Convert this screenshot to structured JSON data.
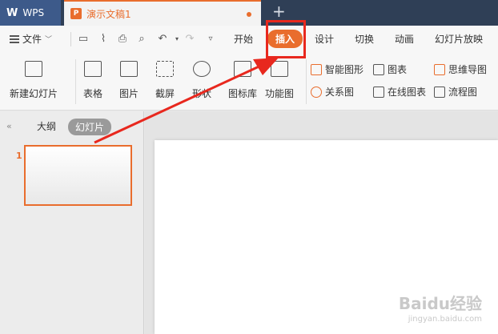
{
  "titlebar": {
    "wps_tab": "WPS",
    "doc_tab": "演示文稿1",
    "new_tab": "+"
  },
  "menubar": {
    "file_label": "文件",
    "tabs": [
      "开始",
      "插入",
      "设计",
      "切换",
      "动画",
      "幻灯片放映"
    ],
    "active_tab": "插入"
  },
  "ribbon": {
    "new_slide": "新建幻灯片",
    "table": "表格",
    "picture": "图片",
    "screenshot": "截屏",
    "shape": "形状",
    "icon_lib": "图标库",
    "func_chart": "功能图",
    "smart_graphic": "智能图形",
    "chart": "图表",
    "mind_map": "思维导图",
    "relation_chart": "关系图",
    "online_chart": "在线图表",
    "flowchart": "流程图"
  },
  "leftpane": {
    "collapse": "«",
    "outline_tab": "大纲",
    "slides_tab": "幻灯片",
    "slide_number": "1"
  },
  "watermark": {
    "brand": "Baidu经验",
    "url": "jingyan.baidu.com"
  },
  "colors": {
    "accent": "#e96d2d",
    "titlebar": "#2f3f56",
    "highlight_box": "#e8281e",
    "arrow": "#e8281e"
  }
}
